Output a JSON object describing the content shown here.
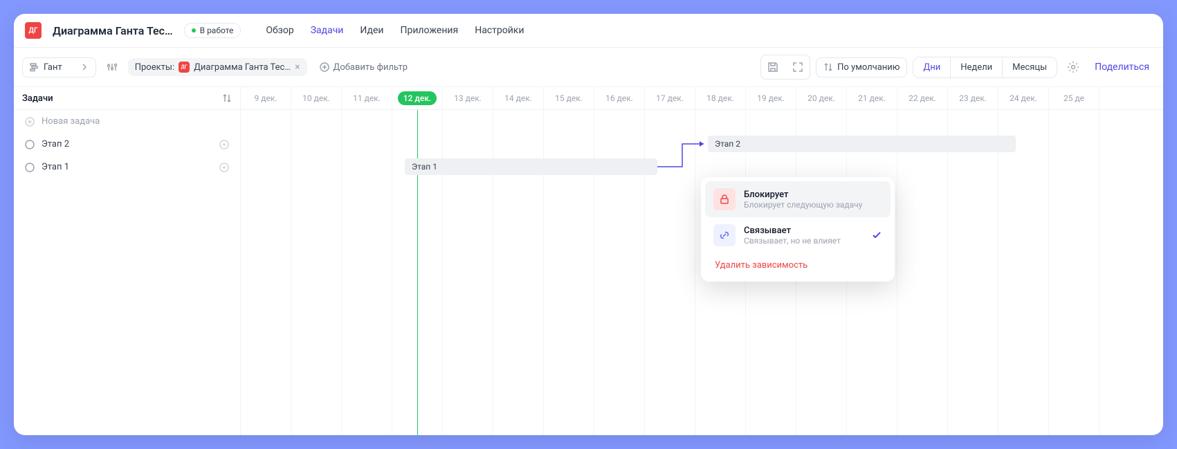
{
  "header": {
    "badge": "ДГ",
    "title": "Диаграмма Ганта Тес…",
    "status": "В работе",
    "tabs": [
      "Обзор",
      "Задачи",
      "Идеи",
      "Приложения",
      "Настройки"
    ],
    "active_tab": 1
  },
  "toolbar": {
    "view_label": "Гант",
    "projects_label": "Проекты:",
    "project_chip": "Диаграмма Ганта Тес…",
    "add_filter": "Добавить фильтр",
    "sort_label": "По умолчанию",
    "zoom": {
      "days": "Дни",
      "weeks": "Недели",
      "months": "Месяцы"
    },
    "share": "Поделиться"
  },
  "sidebar": {
    "heading": "Задачи",
    "new_task": "Новая задача",
    "tasks": [
      "Этап 2",
      "Этап 1"
    ]
  },
  "dates": [
    "9 дек.",
    "10 дек.",
    "11 дек.",
    "12 дек.",
    "13 дек.",
    "14 дек.",
    "15 дек.",
    "16 дек.",
    "17 дек.",
    "18 дек.",
    "19 дек.",
    "20 дек.",
    "21 дек.",
    "22 дек.",
    "23 дек.",
    "24 дек.",
    "25 де"
  ],
  "today_index": 3,
  "bars": {
    "etap2": "Этап 2",
    "etap1": "Этап 1"
  },
  "popup": {
    "block_title": "Блокирует",
    "block_sub": "Блокирует следующую задачу",
    "link_title": "Связывает",
    "link_sub": "Связывает, но не влияет",
    "delete": "Удалить зависимость"
  }
}
